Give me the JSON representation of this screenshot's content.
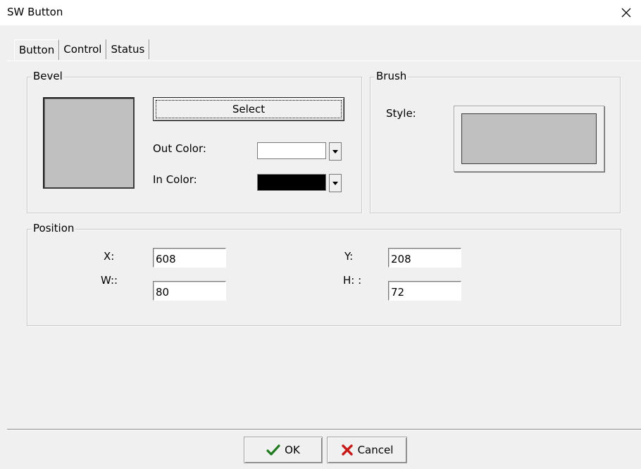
{
  "window": {
    "title": "SW Button",
    "close_icon": "close-icon",
    "close_glyph": "✕"
  },
  "tabs": [
    {
      "label": "Button",
      "active": true
    },
    {
      "label": "Control",
      "active": false
    },
    {
      "label": "Status",
      "active": false
    }
  ],
  "bevel": {
    "group_label": "Bevel",
    "select_label": "Select",
    "out_color_label": "Out Color:",
    "out_color_value": "#ffffff",
    "in_color_label": "In Color:",
    "in_color_value": "#000000",
    "preview_color": "#c0c0c0"
  },
  "brush": {
    "group_label": "Brush",
    "style_label": "Style:",
    "style_color": "#c0c0c0"
  },
  "position": {
    "group_label": "Position",
    "x_label": "X:",
    "x_value": "608",
    "y_label": "Y:",
    "y_value": "208",
    "w_label": "W::",
    "w_value": "80",
    "h_label": "H: :",
    "h_value": "72"
  },
  "footer": {
    "ok_label": "OK",
    "cancel_label": "Cancel",
    "ok_icon": "checkmark-icon",
    "cancel_icon": "x-icon"
  }
}
